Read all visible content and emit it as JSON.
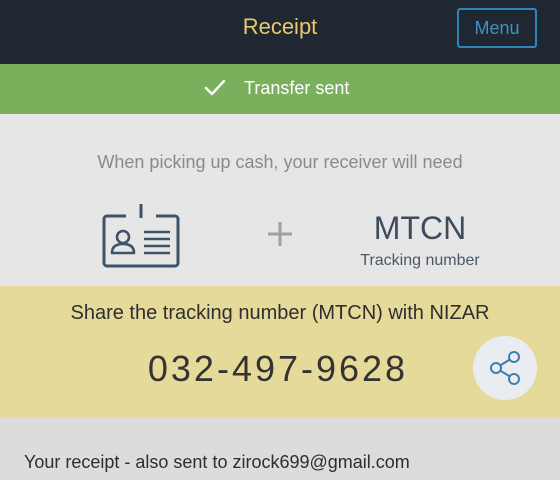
{
  "header": {
    "title": "Receipt",
    "menu_label": "Menu"
  },
  "status": {
    "text": "Transfer sent",
    "icon": "check-icon"
  },
  "pickup": {
    "instruction": "When picking up cash, your receiver will need",
    "id_icon": "id-card-icon",
    "plus_icon": "plus-icon",
    "mtcn_label": "MTCN",
    "mtcn_sub": "Tracking number"
  },
  "share": {
    "instruction": "Share the tracking number (MTCN) with NIZAR",
    "tracking_number": "032-497-9628",
    "share_icon": "share-icon"
  },
  "receipt": {
    "text": "Your receipt - also sent to zirock699@gmail.com"
  },
  "colors": {
    "header_bg": "#1f2732",
    "title": "#e8c86a",
    "menu_border": "#2f86b5",
    "success_bg": "#7aaf5c",
    "share_bg": "#e6da9a",
    "icon_stroke": "#3d5468"
  }
}
